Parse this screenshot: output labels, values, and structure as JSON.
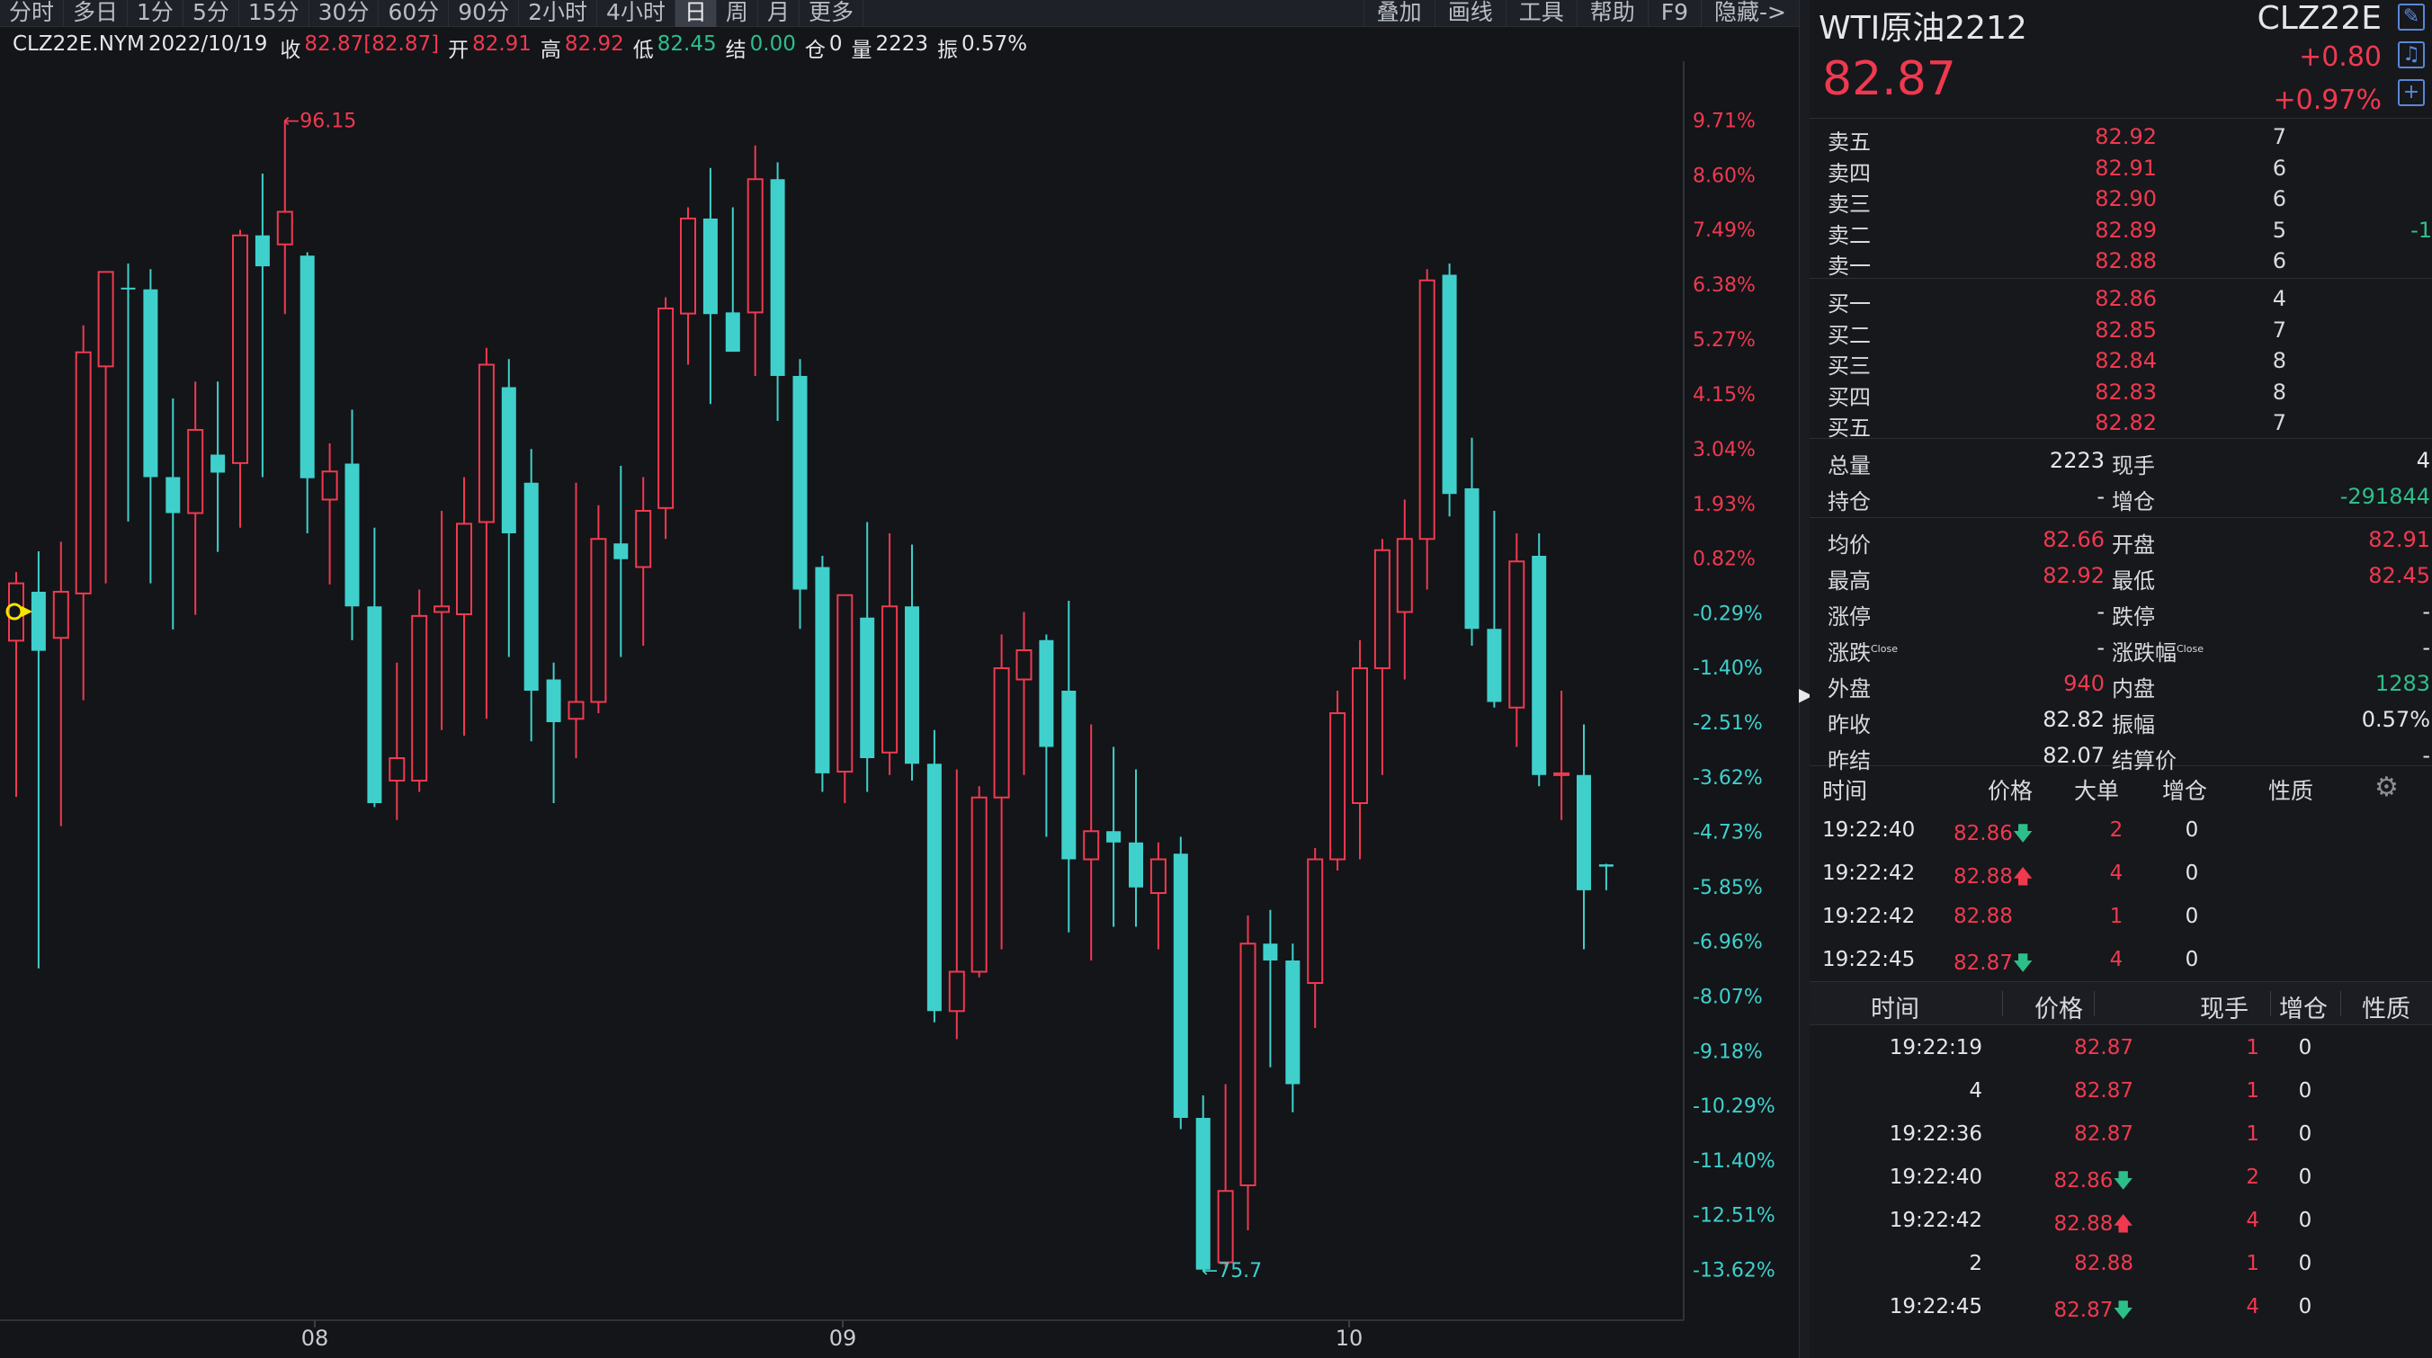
{
  "toolbar": {
    "periods": [
      "分时",
      "多日",
      "1分",
      "5分",
      "15分",
      "30分",
      "60分",
      "90分",
      "2小时",
      "4小时",
      "日",
      "周",
      "月",
      "更多"
    ],
    "active_period": "日",
    "tools": [
      "叠加",
      "画线",
      "工具",
      "帮助",
      "F9",
      "隐藏->"
    ]
  },
  "infobar": {
    "symbol": "CLZ22E.NYM",
    "date": "2022/10/19",
    "close_label": "收",
    "close_value": "82.87[82.87]",
    "open_label": "开",
    "open_value": "82.91",
    "high_label": "高",
    "high_value": "82.92",
    "low_label": "低",
    "low_value": "82.45",
    "settle_label": "结",
    "settle_value": "0.00",
    "oi_label": "仓",
    "oi_value": "0",
    "vol_label": "量",
    "vol_value": "2223",
    "amp_label": "振",
    "amp_value": "0.57%"
  },
  "chart_data": {
    "type": "candlestick",
    "x_labels": [
      "08",
      "09",
      "10"
    ],
    "y_tick_labels": [
      "9.71%",
      "8.60%",
      "7.49%",
      "6.38%",
      "5.27%",
      "4.15%",
      "3.04%",
      "1.93%",
      "0.82%",
      "-0.29%",
      "-1.40%",
      "-2.51%",
      "-3.62%",
      "-4.73%",
      "-5.85%",
      "-6.96%",
      "-8.07%",
      "-9.18%",
      "-10.29%",
      "-11.40%",
      "-12.51%",
      "-13.62%"
    ],
    "reference_price": 87.64,
    "ylim": [
      74.8,
      97.2
    ],
    "annotations": [
      {
        "text": "96.15",
        "kind": "high"
      },
      {
        "text": "75.7",
        "kind": "low"
      }
    ],
    "colors": {
      "up": "#f0394f",
      "down": "#3fd0cc",
      "background": "#131519"
    },
    "candles": [
      {
        "o": 86.89,
        "h": 88.11,
        "l": 84.11,
        "c": 87.91
      },
      {
        "o": 87.76,
        "h": 88.48,
        "l": 81.06,
        "c": 86.71
      },
      {
        "o": 86.94,
        "h": 88.65,
        "l": 83.59,
        "c": 87.76
      },
      {
        "o": 87.73,
        "h": 92.5,
        "l": 85.83,
        "c": 92.02
      },
      {
        "o": 91.77,
        "h": 93.0,
        "l": 87.91,
        "c": 93.45
      },
      {
        "o": 93.17,
        "h": 93.6,
        "l": 89.01,
        "c": 93.14
      },
      {
        "o": 93.14,
        "h": 93.5,
        "l": 87.91,
        "c": 89.8
      },
      {
        "o": 89.8,
        "h": 91.2,
        "l": 87.09,
        "c": 89.16
      },
      {
        "o": 89.16,
        "h": 91.5,
        "l": 87.35,
        "c": 90.64
      },
      {
        "o": 90.2,
        "h": 91.5,
        "l": 88.47,
        "c": 89.88
      },
      {
        "o": 90.05,
        "h": 94.2,
        "l": 88.9,
        "c": 94.1
      },
      {
        "o": 94.1,
        "h": 95.2,
        "l": 89.8,
        "c": 93.55
      },
      {
        "o": 93.94,
        "h": 96.15,
        "l": 92.7,
        "c": 94.52
      },
      {
        "o": 93.74,
        "h": 93.8,
        "l": 88.8,
        "c": 89.78
      },
      {
        "o": 89.4,
        "h": 90.4,
        "l": 87.89,
        "c": 89.9
      },
      {
        "o": 90.04,
        "h": 91.0,
        "l": 86.9,
        "c": 87.5
      },
      {
        "o": 87.5,
        "h": 88.9,
        "l": 83.93,
        "c": 84.0
      },
      {
        "o": 84.4,
        "h": 86.5,
        "l": 83.7,
        "c": 84.8
      },
      {
        "o": 84.4,
        "h": 87.8,
        "l": 84.2,
        "c": 87.33
      },
      {
        "o": 87.4,
        "h": 89.2,
        "l": 85.3,
        "c": 87.5
      },
      {
        "o": 87.36,
        "h": 89.8,
        "l": 85.2,
        "c": 88.97
      },
      {
        "o": 89.0,
        "h": 92.1,
        "l": 85.5,
        "c": 91.8
      },
      {
        "o": 91.4,
        "h": 91.9,
        "l": 86.6,
        "c": 88.8
      },
      {
        "o": 89.7,
        "h": 90.3,
        "l": 85.1,
        "c": 86.0
      },
      {
        "o": 86.2,
        "h": 86.5,
        "l": 84.0,
        "c": 85.44
      },
      {
        "o": 85.5,
        "h": 89.7,
        "l": 84.8,
        "c": 85.8
      },
      {
        "o": 85.8,
        "h": 89.3,
        "l": 85.6,
        "c": 88.7
      },
      {
        "o": 88.62,
        "h": 90.0,
        "l": 86.6,
        "c": 88.34
      },
      {
        "o": 88.2,
        "h": 89.8,
        "l": 86.8,
        "c": 89.2
      },
      {
        "o": 89.25,
        "h": 93.0,
        "l": 88.7,
        "c": 92.8
      },
      {
        "o": 92.71,
        "h": 94.6,
        "l": 91.8,
        "c": 94.4
      },
      {
        "o": 94.4,
        "h": 95.3,
        "l": 91.1,
        "c": 92.7
      },
      {
        "o": 92.73,
        "h": 94.6,
        "l": 92.2,
        "c": 92.03
      },
      {
        "o": 92.73,
        "h": 95.7,
        "l": 91.6,
        "c": 95.1
      },
      {
        "o": 95.1,
        "h": 95.4,
        "l": 90.8,
        "c": 91.6
      },
      {
        "o": 91.6,
        "h": 91.9,
        "l": 87.1,
        "c": 87.8
      },
      {
        "o": 88.2,
        "h": 88.4,
        "l": 84.2,
        "c": 84.53
      },
      {
        "o": 84.56,
        "h": 87.4,
        "l": 84.0,
        "c": 87.7
      },
      {
        "o": 87.3,
        "h": 89.0,
        "l": 84.2,
        "c": 84.8
      },
      {
        "o": 84.9,
        "h": 88.8,
        "l": 84.5,
        "c": 87.5
      },
      {
        "o": 87.5,
        "h": 88.6,
        "l": 84.4,
        "c": 84.7
      },
      {
        "o": 84.7,
        "h": 85.3,
        "l": 80.1,
        "c": 80.3
      },
      {
        "o": 80.3,
        "h": 84.6,
        "l": 79.8,
        "c": 81.0
      },
      {
        "o": 81.0,
        "h": 84.3,
        "l": 80.9,
        "c": 84.1
      },
      {
        "o": 84.1,
        "h": 87.0,
        "l": 81.4,
        "c": 86.4
      },
      {
        "o": 86.2,
        "h": 87.4,
        "l": 84.5,
        "c": 86.72
      },
      {
        "o": 86.9,
        "h": 87.0,
        "l": 83.4,
        "c": 85.0
      },
      {
        "o": 86.0,
        "h": 87.6,
        "l": 81.7,
        "c": 83.0
      },
      {
        "o": 83.0,
        "h": 85.4,
        "l": 81.2,
        "c": 83.5
      },
      {
        "o": 83.5,
        "h": 85.0,
        "l": 81.8,
        "c": 83.3
      },
      {
        "o": 83.3,
        "h": 84.6,
        "l": 81.8,
        "c": 82.5
      },
      {
        "o": 82.4,
        "h": 83.3,
        "l": 81.4,
        "c": 83.0
      },
      {
        "o": 83.1,
        "h": 83.4,
        "l": 78.2,
        "c": 78.4
      },
      {
        "o": 78.4,
        "h": 78.8,
        "l": 75.7,
        "c": 75.7
      },
      {
        "o": 75.83,
        "h": 79.0,
        "l": 75.74,
        "c": 77.1
      },
      {
        "o": 77.2,
        "h": 82.0,
        "l": 76.4,
        "c": 81.5
      },
      {
        "o": 81.5,
        "h": 82.1,
        "l": 79.3,
        "c": 81.2
      },
      {
        "o": 81.2,
        "h": 81.5,
        "l": 78.5,
        "c": 79.0
      },
      {
        "o": 80.8,
        "h": 83.2,
        "l": 80.0,
        "c": 83.0
      },
      {
        "o": 83.0,
        "h": 86.0,
        "l": 82.8,
        "c": 85.6
      },
      {
        "o": 84.0,
        "h": 86.9,
        "l": 83.0,
        "c": 86.4
      },
      {
        "o": 86.4,
        "h": 88.7,
        "l": 84.5,
        "c": 88.5
      },
      {
        "o": 87.4,
        "h": 89.4,
        "l": 86.2,
        "c": 88.7
      },
      {
        "o": 88.7,
        "h": 93.5,
        "l": 87.8,
        "c": 93.3
      },
      {
        "o": 93.4,
        "h": 93.6,
        "l": 89.1,
        "c": 89.5
      },
      {
        "o": 89.6,
        "h": 90.5,
        "l": 86.8,
        "c": 87.1
      },
      {
        "o": 87.1,
        "h": 89.2,
        "l": 85.7,
        "c": 85.8
      },
      {
        "o": 85.7,
        "h": 88.8,
        "l": 85.0,
        "c": 88.3
      },
      {
        "o": 88.4,
        "h": 88.8,
        "l": 84.3,
        "c": 84.5
      },
      {
        "o": 84.5,
        "h": 86.0,
        "l": 83.7,
        "c": 84.53
      },
      {
        "o": 84.5,
        "h": 85.4,
        "l": 81.4,
        "c": 82.45
      },
      {
        "o": 82.91,
        "h": 82.92,
        "l": 82.45,
        "c": 82.87
      }
    ]
  },
  "panel": {
    "name": "WTI原油2212",
    "code": "CLZ22E",
    "last_price": "82.87",
    "change": "+0.80",
    "change_pct": "+0.97%",
    "asks": [
      {
        "label": "卖五",
        "price": "82.92",
        "vol": "7",
        "extra": ""
      },
      {
        "label": "卖四",
        "price": "82.91",
        "vol": "6",
        "extra": ""
      },
      {
        "label": "卖三",
        "price": "82.90",
        "vol": "6",
        "extra": ""
      },
      {
        "label": "卖二",
        "price": "82.89",
        "vol": "5",
        "extra": "-1"
      },
      {
        "label": "卖一",
        "price": "82.88",
        "vol": "6",
        "extra": ""
      }
    ],
    "bids": [
      {
        "label": "买一",
        "price": "82.86",
        "vol": "4"
      },
      {
        "label": "买二",
        "price": "82.85",
        "vol": "7"
      },
      {
        "label": "买三",
        "price": "82.84",
        "vol": "8"
      },
      {
        "label": "买四",
        "price": "82.83",
        "vol": "8"
      },
      {
        "label": "买五",
        "price": "82.82",
        "vol": "7"
      }
    ],
    "stats1": [
      {
        "l1": "总量",
        "v1": "2223",
        "l2": "现手",
        "v2": "4",
        "c1": "white",
        "c2": "white"
      },
      {
        "l1": "持仓",
        "v1": "-",
        "l2": "增仓",
        "v2": "-291844",
        "c1": "white",
        "c2": "green"
      }
    ],
    "stats2": [
      {
        "l1": "均价",
        "v1": "82.66",
        "l2": "开盘",
        "v2": "82.91",
        "c1": "red",
        "c2": "red",
        "sup1": "",
        "sup2": ""
      },
      {
        "l1": "最高",
        "v1": "82.92",
        "l2": "最低",
        "v2": "82.45",
        "c1": "red",
        "c2": "red",
        "sup1": "",
        "sup2": ""
      },
      {
        "l1": "涨停",
        "v1": "-",
        "l2": "跌停",
        "v2": "-",
        "c1": "white",
        "c2": "white",
        "sup1": "",
        "sup2": ""
      },
      {
        "l1": "涨跌",
        "v1": "-",
        "l2": "涨跌幅",
        "v2": "-",
        "c1": "white",
        "c2": "white",
        "sup1": "Close",
        "sup2": "Close"
      },
      {
        "l1": "外盘",
        "v1": "940",
        "l2": "内盘",
        "v2": "1283",
        "c1": "red",
        "c2": "green",
        "sup1": "",
        "sup2": ""
      },
      {
        "l1": "昨收",
        "v1": "82.82",
        "l2": "振幅",
        "v2": "0.57%",
        "c1": "white",
        "c2": "white",
        "sup1": "",
        "sup2": ""
      },
      {
        "l1": "昨结",
        "v1": "82.07",
        "l2": "结算价",
        "v2": "-",
        "c1": "white",
        "c2": "white",
        "sup1": "",
        "sup2": ""
      }
    ],
    "ticks1_header": {
      "time": "时间",
      "price": "价格",
      "big": "大单",
      "oi": "增仓",
      "nature": "性质"
    },
    "ticks1": [
      {
        "time": "19:22:40",
        "price": "82.86",
        "dir": "down",
        "big": "2",
        "oi": "0"
      },
      {
        "time": "19:22:42",
        "price": "82.88",
        "dir": "up",
        "big": "4",
        "oi": "0"
      },
      {
        "time": "19:22:42",
        "price": "82.88",
        "dir": "",
        "big": "1",
        "oi": "0"
      },
      {
        "time": "19:22:45",
        "price": "82.87",
        "dir": "down",
        "big": "4",
        "oi": "0"
      }
    ],
    "ticks2_header": {
      "time": "时间",
      "price": "价格",
      "hand": "现手",
      "oi": "增仓",
      "nature": "性质"
    },
    "ticks2": [
      {
        "time": "19:22:19",
        "price": "82.87",
        "dir": "",
        "hand": "1",
        "oi": "0"
      },
      {
        "time": "4",
        "price": "82.87",
        "dir": "",
        "hand": "1",
        "oi": "0"
      },
      {
        "time": "19:22:36",
        "price": "82.87",
        "dir": "",
        "hand": "1",
        "oi": "0"
      },
      {
        "time": "19:22:40",
        "price": "82.86",
        "dir": "down",
        "hand": "2",
        "oi": "0"
      },
      {
        "time": "19:22:42",
        "price": "82.88",
        "dir": "up",
        "hand": "4",
        "oi": "0"
      },
      {
        "time": "2",
        "price": "82.88",
        "dir": "",
        "hand": "1",
        "oi": "0"
      },
      {
        "time": "19:22:45",
        "price": "82.87",
        "dir": "down",
        "hand": "4",
        "oi": "0"
      }
    ]
  }
}
